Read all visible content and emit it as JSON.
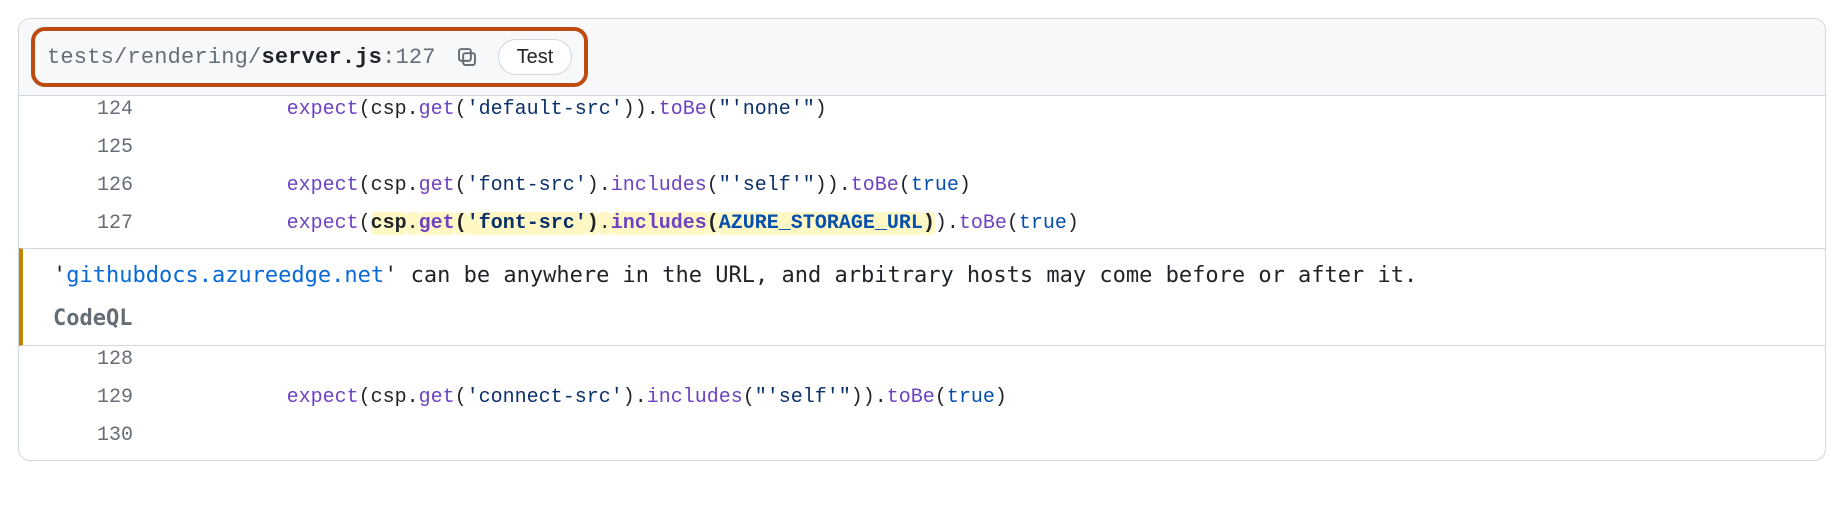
{
  "file": {
    "path_prefix": "tests/rendering/",
    "path_bold": "server.js",
    "line_suffix": ":127",
    "label": "Test"
  },
  "lines": [
    {
      "num": "124",
      "tokens": [
        {
          "cls": "tok-call",
          "t": "expect"
        },
        {
          "cls": "tok-plain",
          "t": "(csp."
        },
        {
          "cls": "tok-call",
          "t": "get"
        },
        {
          "cls": "tok-plain",
          "t": "("
        },
        {
          "cls": "tok-str",
          "t": "'default-src'"
        },
        {
          "cls": "tok-plain",
          "t": "))."
        },
        {
          "cls": "tok-call",
          "t": "toBe"
        },
        {
          "cls": "tok-plain",
          "t": "("
        },
        {
          "cls": "tok-str",
          "t": "\"'none'\""
        },
        {
          "cls": "tok-plain",
          "t": ")"
        }
      ]
    },
    {
      "num": "125",
      "tokens": []
    },
    {
      "num": "126",
      "tokens": [
        {
          "cls": "tok-call",
          "t": "expect"
        },
        {
          "cls": "tok-plain",
          "t": "(csp."
        },
        {
          "cls": "tok-call",
          "t": "get"
        },
        {
          "cls": "tok-plain",
          "t": "("
        },
        {
          "cls": "tok-str",
          "t": "'font-src'"
        },
        {
          "cls": "tok-plain",
          "t": ")."
        },
        {
          "cls": "tok-call",
          "t": "includes"
        },
        {
          "cls": "tok-plain",
          "t": "("
        },
        {
          "cls": "tok-str",
          "t": "\"'self'\""
        },
        {
          "cls": "tok-plain",
          "t": "))."
        },
        {
          "cls": "tok-call",
          "t": "toBe"
        },
        {
          "cls": "tok-plain",
          "t": "("
        },
        {
          "cls": "tok-kw",
          "t": "true"
        },
        {
          "cls": "tok-plain",
          "t": ")"
        }
      ]
    },
    {
      "num": "127",
      "tokens": [
        {
          "cls": "tok-call",
          "t": "expect"
        },
        {
          "cls": "tok-plain",
          "t": "("
        },
        {
          "cls": "tok-plain",
          "hl": true,
          "bold": true,
          "t": "csp"
        },
        {
          "cls": "tok-plain",
          "hl": true,
          "t": "."
        },
        {
          "cls": "tok-call",
          "hl": true,
          "bold": true,
          "t": "get"
        },
        {
          "cls": "tok-plain",
          "hl": true,
          "bold": true,
          "t": "("
        },
        {
          "cls": "tok-str",
          "hl": true,
          "bold": true,
          "t": "'font-src'"
        },
        {
          "cls": "tok-plain",
          "hl": true,
          "bold": true,
          "t": ")"
        },
        {
          "cls": "tok-plain",
          "hl": true,
          "t": "."
        },
        {
          "cls": "tok-call",
          "hl": true,
          "bold": true,
          "t": "includes"
        },
        {
          "cls": "tok-plain",
          "hl": true,
          "bold": true,
          "t": "("
        },
        {
          "cls": "tok-kw",
          "hl": true,
          "bold": true,
          "t": "AZURE_STORAGE_URL"
        },
        {
          "cls": "tok-plain",
          "hl": true,
          "bold": true,
          "t": ")"
        },
        {
          "cls": "tok-plain",
          "t": ")."
        },
        {
          "cls": "tok-call",
          "t": "toBe"
        },
        {
          "cls": "tok-plain",
          "t": "("
        },
        {
          "cls": "tok-kw",
          "t": "true"
        },
        {
          "cls": "tok-plain",
          "t": ")"
        }
      ]
    }
  ],
  "check": {
    "quote1": "'",
    "link": "githubdocs.azureedge.net",
    "quote2": "'",
    "text": " can be anywhere in the URL, and arbitrary hosts may come before or after it.",
    "tool": "CodeQL"
  },
  "lines_after": [
    {
      "num": "128",
      "tokens": []
    },
    {
      "num": "129",
      "tokens": [
        {
          "cls": "tok-call",
          "t": "expect"
        },
        {
          "cls": "tok-plain",
          "t": "(csp."
        },
        {
          "cls": "tok-call",
          "t": "get"
        },
        {
          "cls": "tok-plain",
          "t": "("
        },
        {
          "cls": "tok-str",
          "t": "'connect-src'"
        },
        {
          "cls": "tok-plain",
          "t": ")."
        },
        {
          "cls": "tok-call",
          "t": "includes"
        },
        {
          "cls": "tok-plain",
          "t": "("
        },
        {
          "cls": "tok-str",
          "t": "\"'self'\""
        },
        {
          "cls": "tok-plain",
          "t": "))."
        },
        {
          "cls": "tok-call",
          "t": "toBe"
        },
        {
          "cls": "tok-plain",
          "t": "("
        },
        {
          "cls": "tok-kw",
          "t": "true"
        },
        {
          "cls": "tok-plain",
          "t": ")"
        }
      ]
    },
    {
      "num": "130",
      "tokens": []
    }
  ]
}
